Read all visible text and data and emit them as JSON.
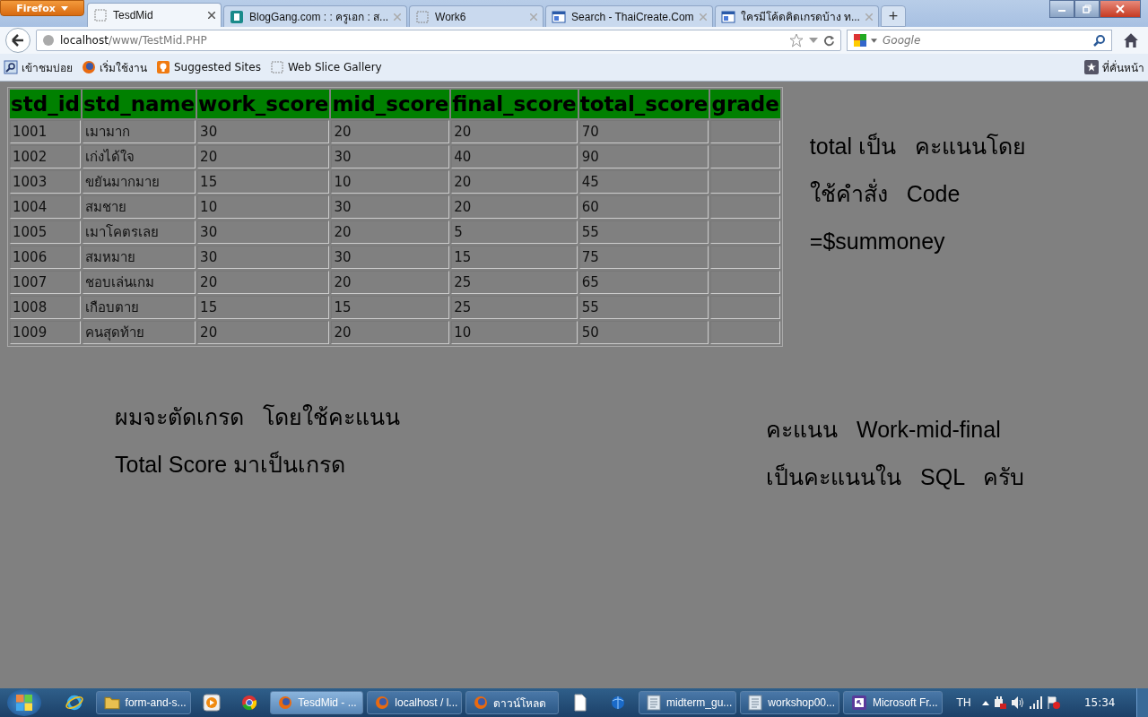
{
  "browser": {
    "app_button": "Firefox",
    "tabs": [
      {
        "title": "TesdMid",
        "selected": true
      },
      {
        "title": "BlogGang.com : : ครูเอก : ส...",
        "selected": false
      },
      {
        "title": "Work6",
        "selected": false
      },
      {
        "title": "Search - ThaiCreate.Com",
        "selected": false
      },
      {
        "title": "ใครมีโค้ดคิดเกรดบ้าง ท...",
        "selected": false
      }
    ],
    "new_tab": "+",
    "url_host": "localhost",
    "url_path": "/www/TestMid.PHP",
    "search_placeholder": "Google",
    "bookmarks": [
      "เข้าชมบ่อย",
      "เริ่มใช้งาน",
      "Suggested Sites",
      "Web Slice Gallery"
    ],
    "bookmarks_menu": "ที่คั่นหน้า"
  },
  "table": {
    "columns": [
      "std_id",
      "std_name",
      "work_score",
      "mid_score",
      "final_score",
      "total_score",
      "grade"
    ],
    "rows": [
      [
        "1001",
        "เมามาก",
        "30",
        "20",
        "20",
        "70",
        ""
      ],
      [
        "1002",
        "เก่งได้ใจ",
        "20",
        "30",
        "40",
        "90",
        ""
      ],
      [
        "1003",
        "ขยันมากมาย",
        "15",
        "10",
        "20",
        "45",
        ""
      ],
      [
        "1004",
        "สมชาย",
        "10",
        "30",
        "20",
        "60",
        ""
      ],
      [
        "1005",
        "เมาโคตรเลย",
        "30",
        "20",
        "5",
        "55",
        ""
      ],
      [
        "1006",
        "สมหมาย",
        "30",
        "30",
        "15",
        "75",
        ""
      ],
      [
        "1007",
        "ชอบเล่นเกม",
        "20",
        "20",
        "25",
        "65",
        ""
      ],
      [
        "1008",
        "เกือบตาย",
        "15",
        "15",
        "25",
        "55",
        ""
      ],
      [
        "1009",
        "คนสุดท้าย",
        "20",
        "20",
        "10",
        "50",
        ""
      ]
    ]
  },
  "notes": {
    "side": [
      "total เป็น   คะแนนโดย",
      "ใช้คำสั่ง   Code",
      "=$summoney"
    ],
    "bottom_left": [
      "ผมจะตัดเกรด   โดยใช้คะแนน",
      "Total Score มาเป็นเกรด"
    ],
    "bottom_right": [
      "คะแนน   Work-mid-final",
      "เป็นคะแนนใน   SQL   ครับ"
    ]
  },
  "taskbar": {
    "items": [
      {
        "kind": "icon"
      },
      {
        "kind": "app",
        "label": "form-and-s...",
        "selected": false
      },
      {
        "kind": "icon"
      },
      {
        "kind": "icon"
      },
      {
        "kind": "app",
        "label": "TesdMid - ...",
        "selected": true
      },
      {
        "kind": "app",
        "label": "localhost / l...",
        "selected": false
      },
      {
        "kind": "app",
        "label": "ดาวน์โหลด",
        "selected": false
      },
      {
        "kind": "icon"
      },
      {
        "kind": "icon"
      },
      {
        "kind": "app",
        "label": "midterm_gu...",
        "selected": false
      },
      {
        "kind": "app",
        "label": "workshop00...",
        "selected": false
      },
      {
        "kind": "app",
        "label": "Microsoft Fr...",
        "selected": false
      }
    ],
    "language": "TH",
    "clock": "15:34"
  }
}
